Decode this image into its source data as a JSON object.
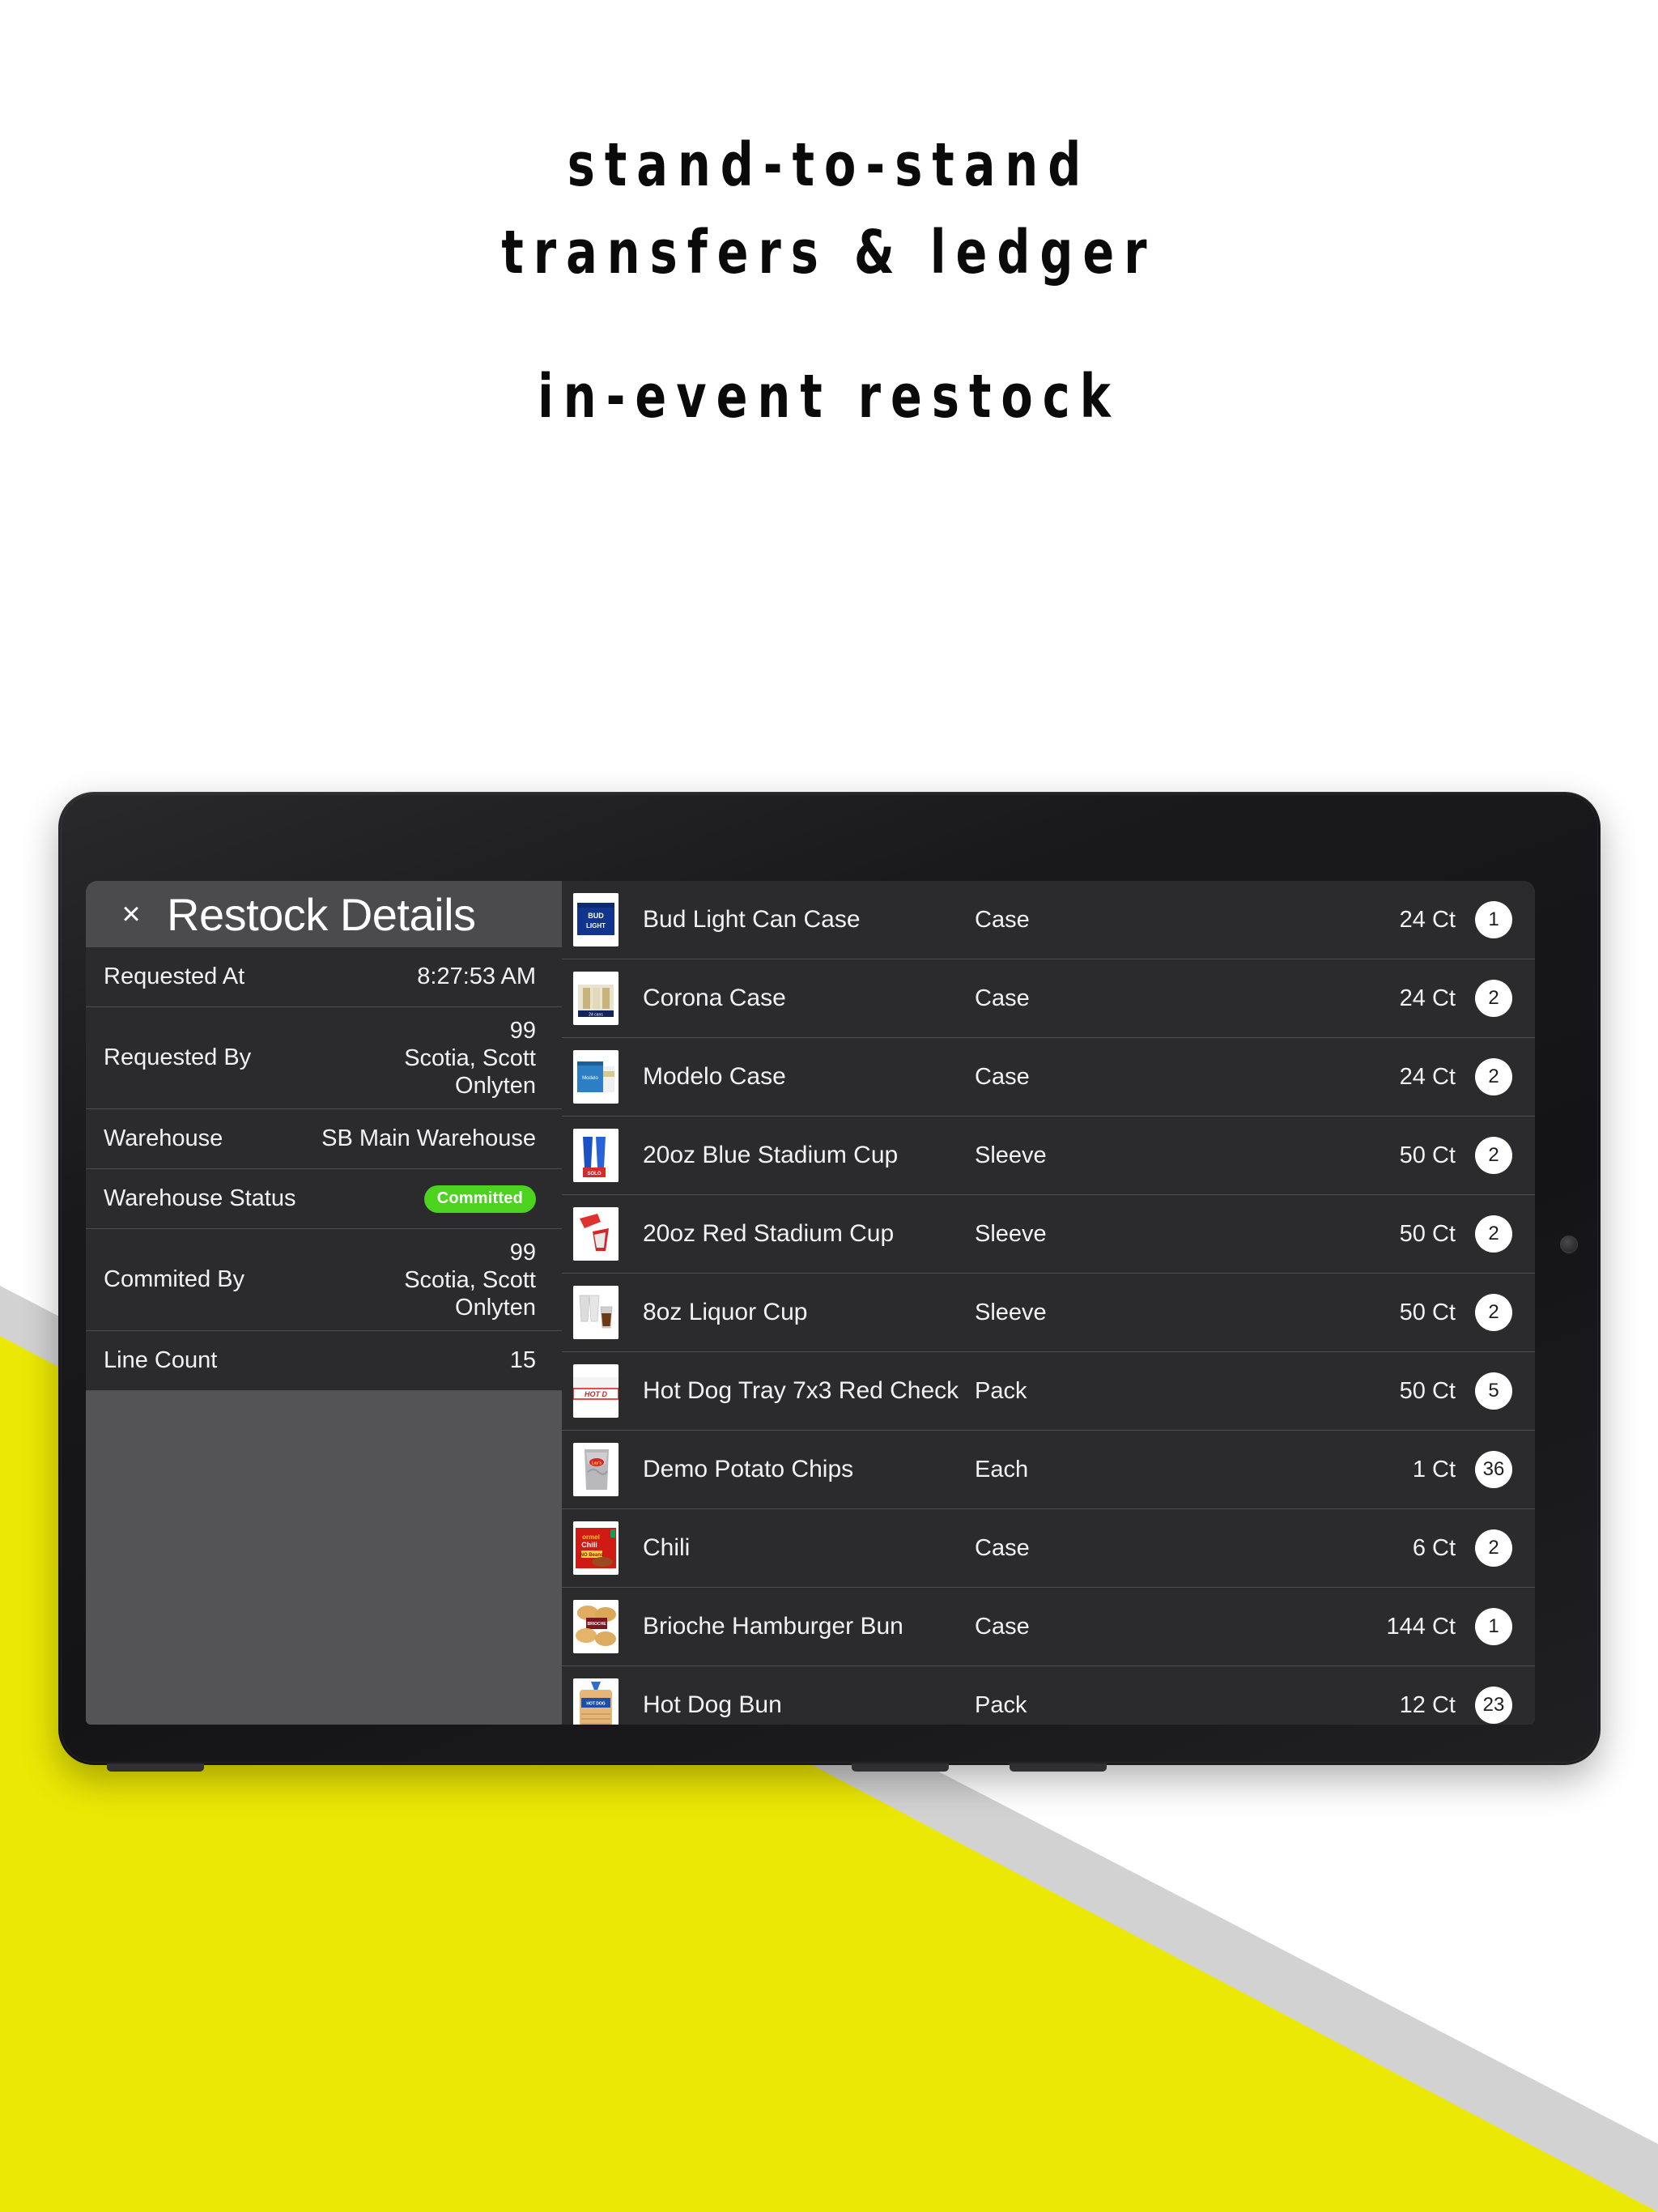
{
  "headline": {
    "line1": "stand-to-stand",
    "line2": "transfers & ledger",
    "line3": "in-event restock"
  },
  "colors": {
    "brand_yellow": "#ece805",
    "brand_grey_stripe": "#d2d2d2",
    "status_green": "#4bd320",
    "panel_dark": "#2b2b2d",
    "panel_grey": "#545456",
    "header_grey": "#4b4b4d"
  },
  "detail": {
    "title": "Restock Details",
    "close_label": "×",
    "rows": [
      {
        "label": "Requested At",
        "value": "8:27:53 AM"
      },
      {
        "label": "Requested By",
        "value_lines": [
          "99",
          "Scotia, Scott",
          "Onlyten"
        ]
      },
      {
        "label": "Warehouse",
        "value": "SB Main Warehouse"
      },
      {
        "label": "Warehouse Status",
        "badge": "Committed"
      },
      {
        "label": "Commited By",
        "value_lines": [
          "99",
          "Scotia, Scott",
          "Onlyten"
        ]
      },
      {
        "label": "Line Count",
        "value": "15"
      }
    ]
  },
  "items": [
    {
      "name": "Bud Light Can Case",
      "unit": "Case",
      "count": "24 Ct",
      "qty": "1",
      "thumb": "bud-light-case-thumb"
    },
    {
      "name": "Corona Case",
      "unit": "Case",
      "count": "24 Ct",
      "qty": "2",
      "thumb": "corona-case-thumb"
    },
    {
      "name": "Modelo Case",
      "unit": "Case",
      "count": "24 Ct",
      "qty": "2",
      "thumb": "modelo-case-thumb"
    },
    {
      "name": "20oz Blue Stadium Cup",
      "unit": "Sleeve",
      "count": "50 Ct",
      "qty": "2",
      "thumb": "blue-cup-thumb"
    },
    {
      "name": "20oz Red Stadium Cup",
      "unit": "Sleeve",
      "count": "50 Ct",
      "qty": "2",
      "thumb": "red-cup-thumb"
    },
    {
      "name": "8oz Liquor Cup",
      "unit": "Sleeve",
      "count": "50 Ct",
      "qty": "2",
      "thumb": "liquor-cup-thumb"
    },
    {
      "name": "Hot Dog Tray 7x3 Red Check",
      "unit": "Pack",
      "count": "50 Ct",
      "qty": "5",
      "thumb": "hot-dog-tray-thumb"
    },
    {
      "name": "Demo Potato Chips",
      "unit": "Each",
      "count": "1 Ct",
      "qty": "36",
      "thumb": "potato-chips-thumb"
    },
    {
      "name": "Chili",
      "unit": "Case",
      "count": "6 Ct",
      "qty": "2",
      "thumb": "chili-thumb"
    },
    {
      "name": "Brioche Hamburger Bun",
      "unit": "Case",
      "count": "144 Ct",
      "qty": "1",
      "thumb": "brioche-bun-thumb"
    },
    {
      "name": "Hot Dog Bun",
      "unit": "Pack",
      "count": "12 Ct",
      "qty": "23",
      "thumb": "hot-dog-bun-thumb"
    }
  ]
}
